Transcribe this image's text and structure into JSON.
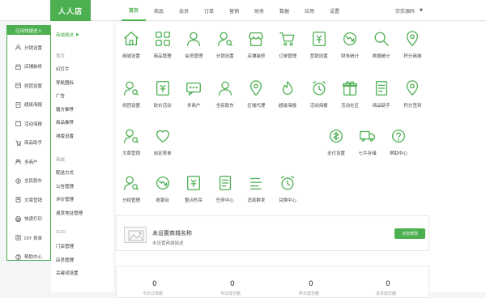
{
  "app": {
    "logo": "人人店"
  },
  "nav": {
    "tabs": [
      "首页",
      "商品",
      "会员",
      "订单",
      "营销",
      "财务",
      "数据",
      "应用",
      "设置"
    ],
    "active_index": 0
  },
  "user": {
    "name": "莎莎源码"
  },
  "quick": {
    "title": "应用快捷进入",
    "items": [
      {
        "label": "分销设置",
        "icon": "users-icon"
      },
      {
        "label": "店铺装修",
        "icon": "shop-icon"
      },
      {
        "label": "拼团设置",
        "icon": "group-icon"
      },
      {
        "label": "超级海报",
        "icon": "poster-icon"
      },
      {
        "label": "活动海报",
        "icon": "activity-icon"
      },
      {
        "label": "商品助手",
        "icon": "cart-icon"
      },
      {
        "label": "多商户",
        "icon": "merchant-icon"
      },
      {
        "label": "全民股东",
        "icon": "shareholder-icon"
      },
      {
        "label": "文章营销",
        "icon": "article-icon"
      },
      {
        "label": "快递打印",
        "icon": "print-icon"
      },
      {
        "label": "DIY 表单",
        "icon": "form-icon"
      },
      {
        "label": "帮助中心",
        "icon": "help-icon"
      }
    ]
  },
  "side2": {
    "head": "商城概述",
    "groups": [
      {
        "title": "首页",
        "items": [
          "幻灯片",
          "导航图标",
          "广告",
          "魔方推荐",
          "商品推荐",
          "排版设置"
        ]
      },
      {
        "title": "商城",
        "items": [
          "配送方式",
          "公告管理",
          "评价管理",
          "退货地址管理"
        ]
      },
      {
        "title": "O2O",
        "items": [
          "门店管理",
          "店员管理",
          "关键词设置"
        ]
      }
    ]
  },
  "icons": {
    "row1": [
      "商城设置",
      "商品管理",
      "会员管理",
      "分销设置",
      "店铺装修",
      "订单管理",
      "营销设置",
      "财务统计",
      "数据统计",
      "积分商城"
    ],
    "row2": [
      "拼团设置",
      "砍价活动",
      "多商户",
      "全民股东",
      "区域代理",
      "超级海报",
      "活动海报",
      "活动社区",
      "商品助手",
      "积分签到"
    ],
    "row3a": [
      "文章营销",
      "自定表单"
    ],
    "row3b": [
      "支付设置",
      "七牛存储",
      "帮助中心"
    ],
    "row4": [
      "分权管理",
      "收银台",
      "整点秒杀",
      "任务中心",
      "消息群发",
      "兑换中心"
    ]
  },
  "shop": {
    "name": "未设置商城名称",
    "desc": "未设置商城描述",
    "edit_label": "点击修改"
  },
  "stats": [
    {
      "value": "0",
      "label": "今日订单数"
    },
    {
      "value": "0",
      "label": "今日成交额"
    },
    {
      "value": "0",
      "label": "昨日成交额"
    },
    {
      "value": "0",
      "label": "本月成交额"
    }
  ],
  "colors": {
    "accent": "#4caf50"
  }
}
